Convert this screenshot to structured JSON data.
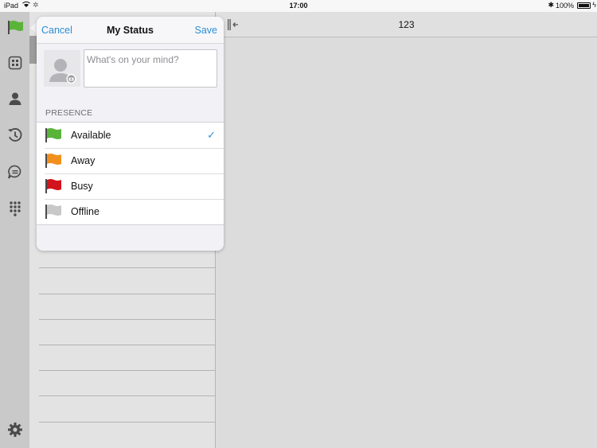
{
  "status_bar": {
    "device": "iPad",
    "time": "17:00",
    "battery": "100%"
  },
  "detail": {
    "title": "123"
  },
  "popover": {
    "cancel_label": "Cancel",
    "title": "My Status",
    "save_label": "Save",
    "mind_placeholder": "What's on your mind?",
    "mind_value": "",
    "section_header": "PRESENCE",
    "presence": [
      {
        "label": "Available",
        "color": "#5ab43a",
        "selected": true
      },
      {
        "label": "Away",
        "color": "#f2901e",
        "selected": false
      },
      {
        "label": "Busy",
        "color": "#d1141b",
        "selected": false
      },
      {
        "label": "Offline",
        "color": "#c8c8c8",
        "selected": false
      }
    ]
  },
  "rail": {
    "icons": [
      "flag-icon",
      "building-icon",
      "contact-icon",
      "history-icon",
      "chat-icon",
      "dialpad-icon",
      "settings-icon"
    ]
  },
  "colors": {
    "accent": "#2a8ed6",
    "available": "#5ab43a"
  }
}
